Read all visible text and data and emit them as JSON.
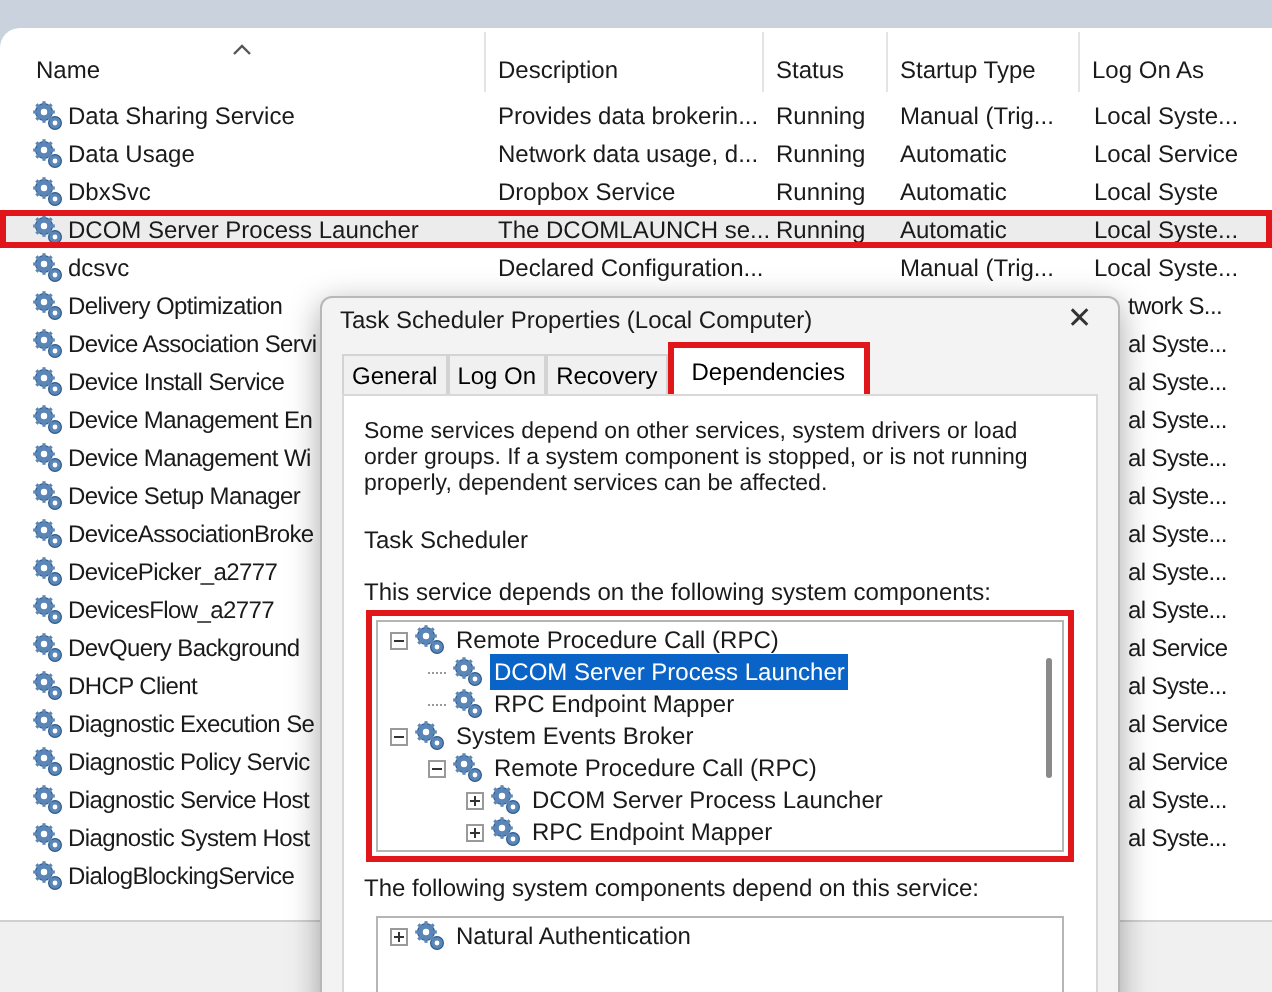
{
  "columns": [
    {
      "label": "Name",
      "sorted": true
    },
    {
      "label": "Description",
      "sorted": false
    },
    {
      "label": "Status",
      "sorted": false
    },
    {
      "label": "Startup Type",
      "sorted": false
    },
    {
      "label": "Log On As",
      "sorted": false
    }
  ],
  "services": [
    {
      "kind": "full",
      "name": "Data Sharing Service",
      "description": "Provides data brokerin...",
      "status": "Running",
      "startup": "Manual (Trig...",
      "log_on": "Local Syste...",
      "selected": false,
      "highlighted": false
    },
    {
      "kind": "full",
      "name": "Data Usage",
      "description": "Network data usage, d...",
      "status": "Running",
      "startup": "Automatic",
      "log_on": "Local Service",
      "selected": false,
      "highlighted": false
    },
    {
      "kind": "full",
      "name": "DbxSvc",
      "description": "Dropbox Service",
      "status": "Running",
      "startup": "Automatic",
      "log_on": "Local Syste",
      "selected": false,
      "highlighted": false
    },
    {
      "kind": "full",
      "name": "DCOM Server Process Launcher",
      "description": "The DCOMLAUNCH se...",
      "status": "Running",
      "startup": "Automatic",
      "log_on": "Local Syste...",
      "selected": true,
      "highlighted": true
    },
    {
      "kind": "full",
      "name": "dcsvc",
      "description": "Declared Configuration...",
      "startup": "Manual (Trig...",
      "log_on": "Local Syste...",
      "selected": false,
      "highlighted": false
    },
    {
      "kind": "partial",
      "name": "Delivery Optimization",
      "log_on": "twork S...",
      "selected": false,
      "highlighted": false
    },
    {
      "kind": "partial",
      "name": "Device Association Servi",
      "log_on": "al Syste...",
      "selected": false,
      "highlighted": false
    },
    {
      "kind": "partial",
      "name": "Device Install Service",
      "log_on": "al Syste...",
      "selected": false,
      "highlighted": false
    },
    {
      "kind": "partial",
      "name": "Device Management En",
      "log_on": "al Syste...",
      "selected": false,
      "highlighted": false
    },
    {
      "kind": "partial",
      "name": "Device Management Wi",
      "log_on": "al Syste...",
      "selected": false,
      "highlighted": false
    },
    {
      "kind": "partial",
      "name": "Device Setup Manager",
      "log_on": "al Syste...",
      "selected": false,
      "highlighted": false
    },
    {
      "kind": "partial",
      "name": "DeviceAssociationBroke",
      "log_on": "al Syste...",
      "selected": false,
      "highlighted": false
    },
    {
      "kind": "partial",
      "name": "DevicePicker_a2777",
      "log_on": "al Syste...",
      "selected": false,
      "highlighted": false
    },
    {
      "kind": "partial",
      "name": "DevicesFlow_a2777",
      "log_on": "al Syste...",
      "selected": false,
      "highlighted": false
    },
    {
      "kind": "partial",
      "name": "DevQuery Background",
      "log_on": "al Service",
      "selected": false,
      "highlighted": false
    },
    {
      "kind": "partial",
      "name": "DHCP Client",
      "log_on": "al Syste...",
      "selected": false,
      "highlighted": false
    },
    {
      "kind": "partial",
      "name": "Diagnostic Execution Se",
      "log_on": "al Service",
      "selected": false,
      "highlighted": false
    },
    {
      "kind": "partial",
      "name": "Diagnostic Policy Servic",
      "log_on": "al Service",
      "selected": false,
      "highlighted": false
    },
    {
      "kind": "partial",
      "name": "Diagnostic Service Host",
      "log_on": "al Syste...",
      "selected": false,
      "highlighted": false
    },
    {
      "kind": "partial",
      "name": "Diagnostic System Host",
      "log_on": "al Syste...",
      "selected": false,
      "highlighted": false
    },
    {
      "kind": "partial",
      "name": "DialogBlockingService",
      "selected": false,
      "highlighted": false
    }
  ],
  "dialog": {
    "title": "Task Scheduler Properties (Local Computer)",
    "close": "✕",
    "tabs": [
      {
        "label": "General",
        "selected": false,
        "highlighted": false
      },
      {
        "label": "Log On",
        "selected": false,
        "highlighted": false
      },
      {
        "label": "Recovery",
        "selected": false,
        "highlighted": false
      },
      {
        "label": "Dependencies",
        "selected": true,
        "highlighted": true
      }
    ],
    "description": "Some services depend on other services, system drivers or load order groups. If a system component is stopped, or is not running properly, dependent services can be affected.",
    "service_name": "Task Scheduler",
    "depends_on_label": "This service depends on the following system components:",
    "depends_on_tree": {
      "highlighted": true,
      "items": [
        {
          "label": "Remote Procedure Call (RPC)",
          "expanded": true,
          "selected": false,
          "children": [
            {
              "label": "DCOM Server Process Launcher",
              "selected": true
            },
            {
              "label": "RPC Endpoint Mapper",
              "selected": false
            }
          ]
        },
        {
          "label": "System Events Broker",
          "expanded": true,
          "selected": false,
          "children": [
            {
              "label": "Remote Procedure Call (RPC)",
              "expanded": true,
              "selected": false,
              "children": [
                {
                  "label": "DCOM Server Process Launcher",
                  "expanded": false,
                  "selected": false
                },
                {
                  "label": "RPC Endpoint Mapper",
                  "expanded": false,
                  "selected": false
                }
              ]
            }
          ]
        }
      ]
    },
    "dependents_label": "The following system components depend on this service:",
    "dependents_tree": {
      "items": [
        {
          "label": "Natural Authentication",
          "expanded": false,
          "selected": false
        }
      ]
    }
  }
}
